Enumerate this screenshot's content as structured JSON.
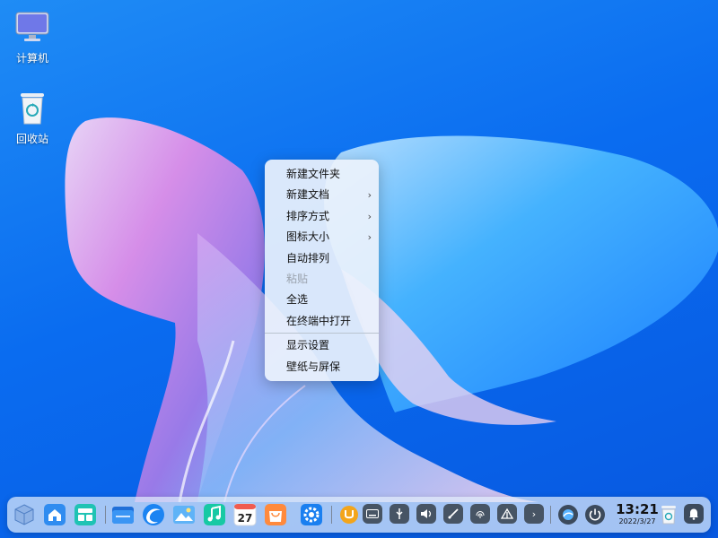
{
  "desktop": {
    "icons": [
      {
        "label": "计算机",
        "icon": "computer-monitor-icon"
      },
      {
        "label": "回收站",
        "icon": "recycle-bin-icon"
      }
    ]
  },
  "context_menu": {
    "items": [
      {
        "label": "新建文件夹"
      },
      {
        "label": "新建文档",
        "arrow": "›"
      },
      {
        "label": "排序方式",
        "arrow": "›"
      },
      {
        "label": "图标大小",
        "arrow": "›"
      },
      {
        "label": "自动排列"
      },
      {
        "label": "粘贴",
        "disabled": true
      },
      {
        "label": "全选"
      },
      {
        "label": "在终端中打开"
      },
      {
        "label": "显示设置"
      },
      {
        "label": "壁纸与屏保"
      }
    ]
  },
  "dock": {
    "calendar_day": "27",
    "tray_arrow": "›",
    "clock": {
      "time": "13:21",
      "date": "2022/3/27"
    }
  }
}
